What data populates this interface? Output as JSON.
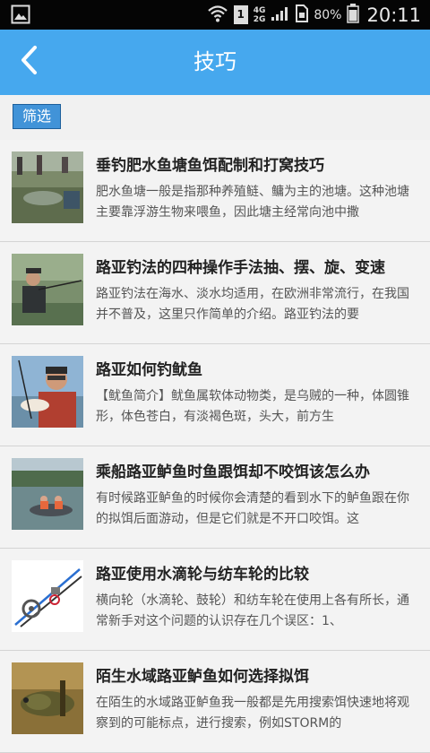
{
  "status_bar": {
    "network": "4G",
    "network2": "2G",
    "sim": "1",
    "battery": "80%",
    "time": "20:11",
    "icons": [
      "image-icon",
      "wifi-icon",
      "sim-icon",
      "signal-icon",
      "battery-icon"
    ]
  },
  "header": {
    "title": "技巧",
    "back_icon": "chevron-left-icon"
  },
  "filter": {
    "label": "筛选"
  },
  "articles": [
    {
      "title": "垂钓肥水鱼塘鱼饵配制和打窝技巧",
      "desc": "肥水鱼塘一般是指那种养殖鲢、鳙为主的池塘。这种池塘主要靠浮游生物来喂鱼，因此塘主经常向池中撒"
    },
    {
      "title": "路亚钓法的四种操作手法抽、摆、旋、变速",
      "desc": "路亚钓法在海水、淡水均适用，在欧洲非常流行，在我国并不普及，这里只作简单的介绍。路亚钓法的要"
    },
    {
      "title": "路亚如何钓鱿鱼",
      "desc": "【鱿鱼简介】鱿鱼属软体动物类，是乌贼的一种，体圆锥形，体色苍白，有淡褐色斑，头大，前方生"
    },
    {
      "title": "乘船路亚鲈鱼时鱼跟饵却不咬饵该怎么办",
      "desc": "有时候路亚鲈鱼的时候你会清楚的看到水下的鲈鱼跟在你的拟饵后面游动，但是它们就是不开口咬饵。这"
    },
    {
      "title": "路亚使用水滴轮与纺车轮的比较",
      "desc": "横向轮（水滴轮、鼓轮）和纺车轮在使用上各有所长，通常新手对这个问题的认识存在几个误区：1、"
    },
    {
      "title": "陌生水域路亚鲈鱼如何选择拟饵",
      "desc": "在陌生的水域路亚鲈鱼我一般都是先用搜索饵快速地将观察到的可能标点，进行搜索，例如STORM的"
    }
  ],
  "colors": {
    "app_bar": "#46a8ee",
    "filter_button": "#4193d8",
    "list_bg": "#f3f3f3"
  }
}
